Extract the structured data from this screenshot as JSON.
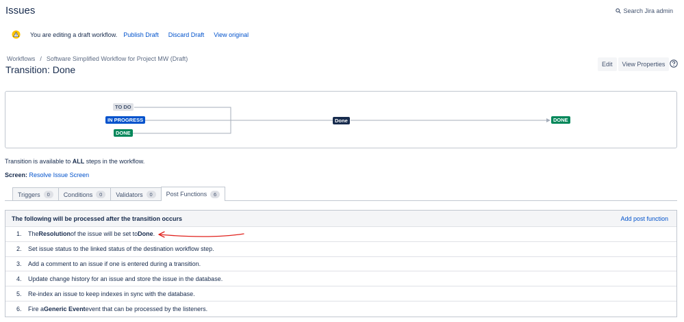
{
  "header": {
    "title": "Issues",
    "search_label": "Search Jira admin"
  },
  "draft_bar": {
    "message": "You are editing a draft workflow.",
    "publish": "Publish Draft",
    "discard": "Discard Draft",
    "view_original": "View original"
  },
  "breadcrumb": {
    "workflows": "Workflows",
    "separator": "/",
    "current": "Software Simplified Workflow for Project MW (Draft)"
  },
  "page": {
    "title": "Transition: Done"
  },
  "actions": {
    "edit": "Edit",
    "view_properties": "View Properties"
  },
  "diagram": {
    "sources": [
      "TO DO",
      "IN PROGRESS",
      "DONE"
    ],
    "transition": "Done",
    "target": "DONE"
  },
  "info": {
    "avail_prefix": "Transition is available to ",
    "avail_bold": "ALL",
    "avail_suffix": " steps in the workflow.",
    "screen_label": "Screen:",
    "screen_link": "Resolve Issue Screen"
  },
  "tabs": [
    {
      "label": "Triggers",
      "count": "0"
    },
    {
      "label": "Conditions",
      "count": "0"
    },
    {
      "label": "Validators",
      "count": "0"
    },
    {
      "label": "Post Functions",
      "count": "6"
    }
  ],
  "post_functions": {
    "header": "The following will be processed after the transition occurs",
    "add_link": "Add post function",
    "items": [
      {
        "num": "1.",
        "parts": [
          "The ",
          "Resolution",
          " of the issue will be set to ",
          "Done",
          "."
        ]
      },
      {
        "num": "2.",
        "text": "Set issue status to the linked status of the destination workflow step."
      },
      {
        "num": "3.",
        "text": "Add a comment to an issue if one is entered during a transition."
      },
      {
        "num": "4.",
        "text": "Update change history for an issue and store the issue in the database."
      },
      {
        "num": "5.",
        "text": "Re-index an issue to keep indexes in sync with the database."
      },
      {
        "num": "6.",
        "parts": [
          "Fire a ",
          "Generic Event",
          " event that can be processed by the listeners."
        ]
      }
    ]
  },
  "colors": {
    "link": "#0052cc",
    "in_progress": "#0052cc",
    "done": "#00875a",
    "todo": "#dfe1e6",
    "annotation": "#e0201b"
  }
}
